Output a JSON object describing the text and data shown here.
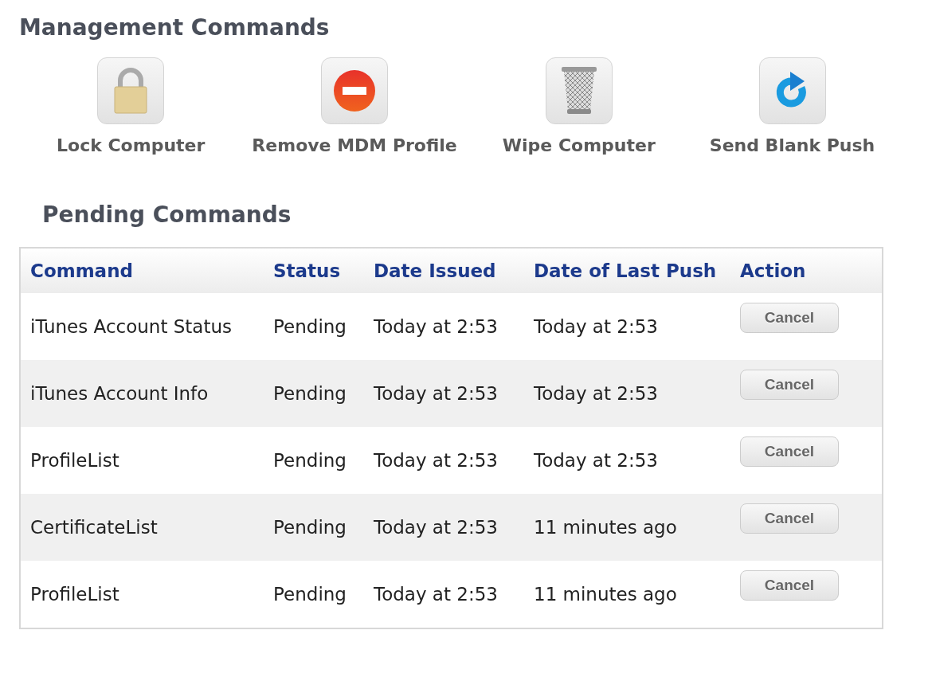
{
  "management": {
    "title": "Management Commands",
    "commands": [
      {
        "kind": "lock",
        "label": "Lock Computer"
      },
      {
        "kind": "remove",
        "label": "Remove MDM Profile"
      },
      {
        "kind": "trash",
        "label": "Wipe Computer"
      },
      {
        "kind": "push",
        "label": "Send Blank Push"
      }
    ]
  },
  "pending": {
    "title": "Pending Commands",
    "columns": [
      "Command",
      "Status",
      "Date Issued",
      "Date of Last Push",
      "Action"
    ],
    "rows": [
      {
        "command": "iTunes Account Status",
        "status": "Pending",
        "date_issued": "Today at 2:53",
        "last_push": "Today at 2:53",
        "action": "Cancel"
      },
      {
        "command": "iTunes Account Info",
        "status": "Pending",
        "date_issued": "Today at 2:53",
        "last_push": "Today at 2:53",
        "action": "Cancel"
      },
      {
        "command": "ProfileList",
        "status": "Pending",
        "date_issued": "Today at 2:53",
        "last_push": "Today at 2:53",
        "action": "Cancel"
      },
      {
        "command": "CertificateList",
        "status": "Pending",
        "date_issued": "Today at 2:53",
        "last_push": "11 minutes ago",
        "action": "Cancel"
      },
      {
        "command": "ProfileList",
        "status": "Pending",
        "date_issued": "Today at 2:53",
        "last_push": "11 minutes ago",
        "action": "Cancel"
      }
    ]
  }
}
